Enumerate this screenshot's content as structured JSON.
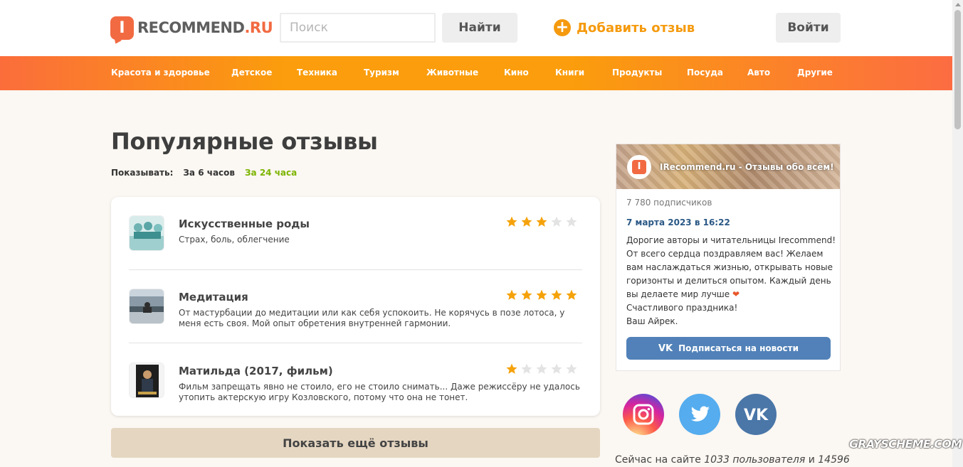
{
  "header": {
    "logo_letter": "I",
    "logo_main": "RECOMMEND",
    "logo_tld": ".RU",
    "search_placeholder": "Поиск",
    "search_button": "Найти",
    "add_review": "Добавить отзыв",
    "login": "Войти"
  },
  "nav": {
    "items": [
      "Красота и здоровье",
      "Детское",
      "Техника",
      "Туризм",
      "Животные",
      "Кино",
      "Книги",
      "Продукты",
      "Посуда",
      "Авто",
      "Другие"
    ]
  },
  "main": {
    "title": "Популярные отзывы",
    "filter_label": "Показывать:",
    "filter_6h": "За 6 часов",
    "filter_24h": "За 24 часа",
    "reviews": [
      {
        "title": "Искусственные роды",
        "desc": "Страх, боль, облегчение",
        "rating": 3
      },
      {
        "title": "Медитация",
        "desc": "От мастурбации до медитации или как себя успокоить. Не корячусь в позе лотоса, у меня есть своя. Мой опыт обретения внутренней гармонии.",
        "rating": 5
      },
      {
        "title": "Матильда (2017, фильм)",
        "desc": "Фильм запрещать явно не стоило, его не стоило снимать... Даже режиссёру не удалось утопить актерскую игру Козловского, потому что она не тонет.",
        "rating": 1
      }
    ],
    "more_button": "Показать ещё отзывы"
  },
  "widget": {
    "title": "IRecommend.ru - Отзывы обо всём!",
    "subscribers": "7 780 подписчиков",
    "date": "7 марта 2023 в 16:22",
    "lines": [
      "Дорогие авторы и читательницы Irecommend!",
      "От всего сердца поздравляем вас! Желаем",
      "вам наслаждаться жизнью, открывать новые",
      "горизонты и делиться опытом. Каждый день",
      "вы делаете мир лучше",
      "Счастливого праздника!",
      "Ваш Айрек."
    ],
    "heart": "❤",
    "vk_label": "Подписаться на новости",
    "vk_glyph": "VK"
  },
  "online": {
    "prefix": "Сейчас на сайте",
    "users": "1033 пользователя",
    "and": "и",
    "guests": "14596"
  },
  "watermark": "GRAYSCHEME.COM",
  "colors": {
    "accent": "#f26a42",
    "orange": "#fb9d0c",
    "vk": "#5181b8",
    "active_filter": "#7cb400",
    "star_on": "#f5a20a",
    "star_off": "#e3e3e3"
  },
  "icons": [
    "logo-mark-icon",
    "plus-icon",
    "star-icon",
    "vk-icon",
    "instagram-icon",
    "twitter-icon",
    "scroll-up-arrow-icon"
  ]
}
